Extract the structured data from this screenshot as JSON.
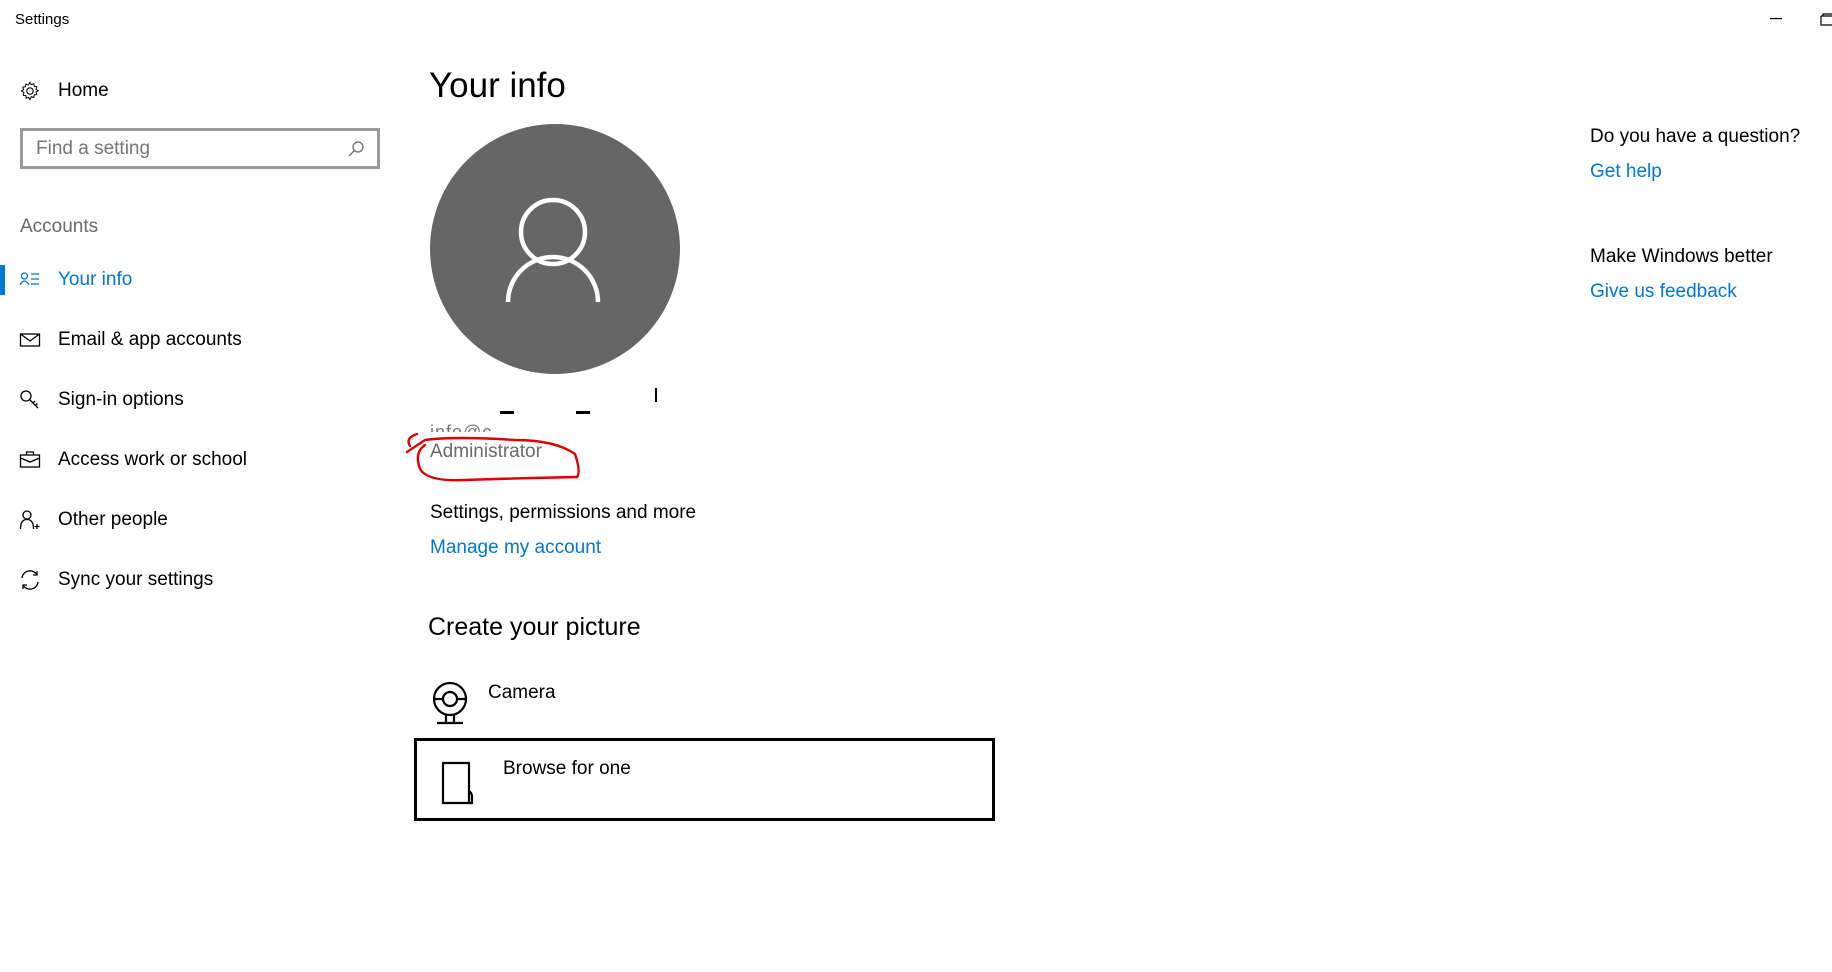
{
  "window": {
    "title": "Settings",
    "minimize_icon": "minimize-icon",
    "maximize_icon": "maximize-icon"
  },
  "sidebar": {
    "home": {
      "label": "Home",
      "icon": "gear-icon"
    },
    "search": {
      "placeholder": "Find a setting",
      "value": "",
      "icon": "search-icon"
    },
    "section_label": "Accounts",
    "items": [
      {
        "label": "Your info",
        "icon": "contact-info-icon",
        "active": true
      },
      {
        "label": "Email & app accounts",
        "icon": "mail-icon",
        "active": false
      },
      {
        "label": "Sign-in options",
        "icon": "key-icon",
        "active": false
      },
      {
        "label": "Access work or school",
        "icon": "briefcase-icon",
        "active": false
      },
      {
        "label": "Other people",
        "icon": "add-person-icon",
        "active": false
      },
      {
        "label": "Sync your settings",
        "icon": "sync-icon",
        "active": false
      }
    ]
  },
  "main": {
    "title": "Your info",
    "avatar_icon": "person-icon",
    "account": {
      "name": "[redacted]",
      "email_fragment": "info@c",
      "role": "Administrator"
    },
    "permissions_label": "Settings, permissions and more",
    "manage_link": "Manage my account",
    "picture_section": {
      "title": "Create your picture",
      "options": [
        {
          "label": "Camera",
          "icon": "webcam-icon"
        },
        {
          "label": "Browse for one",
          "icon": "document-icon",
          "focused": true
        }
      ]
    }
  },
  "side_panel": {
    "question_label": "Do you have a question?",
    "help_link": "Get help",
    "improve_label": "Make Windows better",
    "feedback_link": "Give us feedback"
  },
  "colors": {
    "accent": "#0078d7",
    "avatar_bg": "#666666",
    "annotation": "#e00000"
  }
}
